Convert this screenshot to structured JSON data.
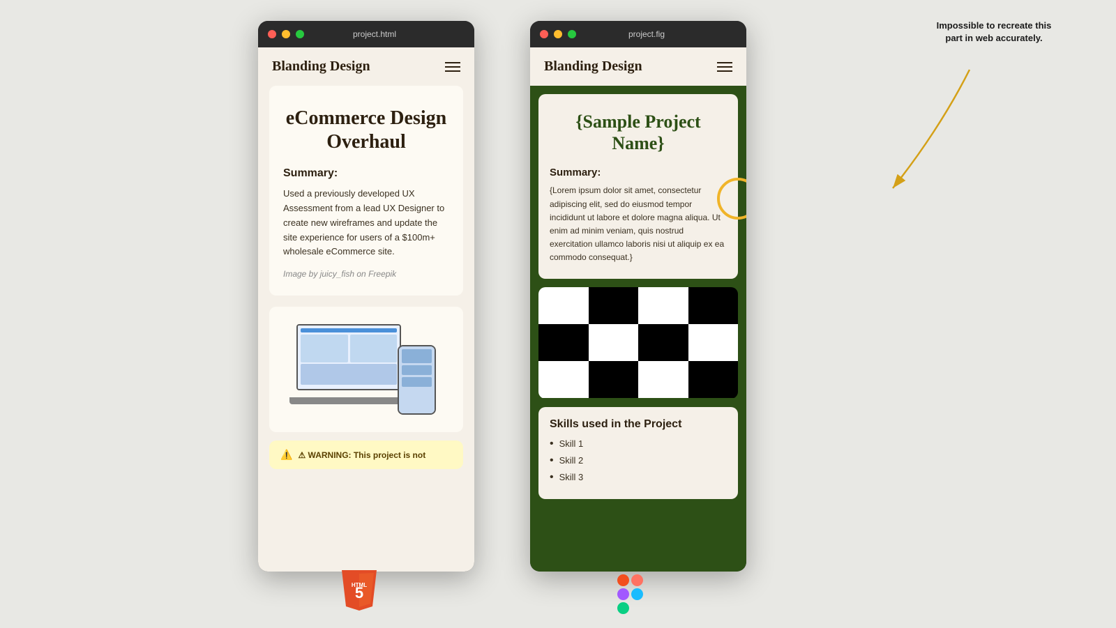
{
  "page": {
    "background_color": "#e8e8e4"
  },
  "left_browser": {
    "title": "project.html",
    "site_name": "Blanding Design",
    "project_title": "eCommerce Design Overhaul",
    "summary_label": "Summary:",
    "summary_text": "Used a previously developed UX Assessment from a lead UX Designer to create new wireframes and update the site experience for users of a $100m+ wholesale eCommerce site.",
    "image_credit": "Image by juicy_fish on Freepik",
    "warning_text": "⚠ WARNING: This project is not"
  },
  "right_browser": {
    "title": "project.fig",
    "site_name": "Blanding Design",
    "project_title": "{Sample Project Name}",
    "summary_label": "Summary:",
    "summary_text": "{Lorem ipsum dolor sit amet, consectetur adipiscing elit, sed do eiusmod tempor incididunt ut labore et dolore magna aliqua. Ut enim ad minim veniam, quis nostrud exercitation ullamco laboris nisi ut aliquip ex ea commodo consequat.}",
    "skills_section_title": "Skills used in the Project",
    "skills": [
      "Skill 1",
      "Skill 2",
      "Skill 3"
    ]
  },
  "annotation": {
    "text": "Impossible to recreate this part in web accurately."
  },
  "logos": {
    "html5_text": "HTML",
    "html5_number": "5",
    "figma_label": "Figma"
  }
}
